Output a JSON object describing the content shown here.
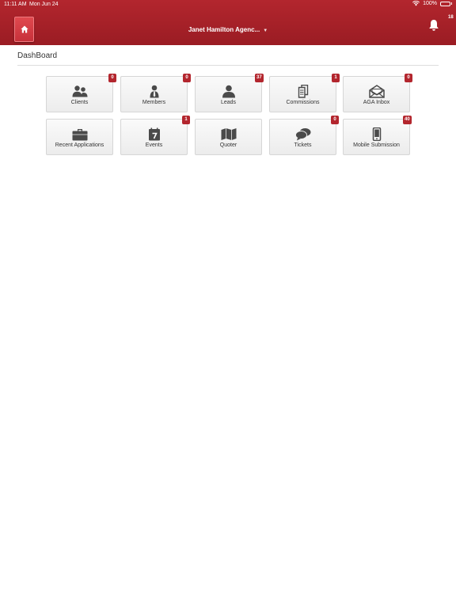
{
  "status_bar": {
    "time": "11:11 AM",
    "date": "Mon Jun 24",
    "battery": "100%"
  },
  "header": {
    "agency": "Janet Hamilton Agenc...",
    "notification_count": "18"
  },
  "page": {
    "title": "DashBoard"
  },
  "colors": {
    "header": "#b3262e",
    "badge": "#b3262e",
    "icon": "#4a4a4a"
  },
  "tiles": [
    {
      "label": "Clients",
      "badge": "0",
      "icon": "users-icon"
    },
    {
      "label": "Members",
      "badge": "0",
      "icon": "member-icon"
    },
    {
      "label": "Leads",
      "badge": "37",
      "icon": "user-icon"
    },
    {
      "label": "Commissions",
      "badge": "1",
      "icon": "documents-icon"
    },
    {
      "label": "AGA Inbox",
      "badge": "0",
      "icon": "envelope-icon"
    },
    {
      "label": "Recent Applications",
      "badge": "",
      "icon": "briefcase-icon"
    },
    {
      "label": "Events",
      "badge": "1",
      "icon": "calendar-icon"
    },
    {
      "label": "Quoter",
      "badge": "",
      "icon": "map-icon"
    },
    {
      "label": "Tickets",
      "badge": "0",
      "icon": "chat-icon"
    },
    {
      "label": "Mobile Submission",
      "badge": "40",
      "icon": "mobile-icon"
    }
  ]
}
